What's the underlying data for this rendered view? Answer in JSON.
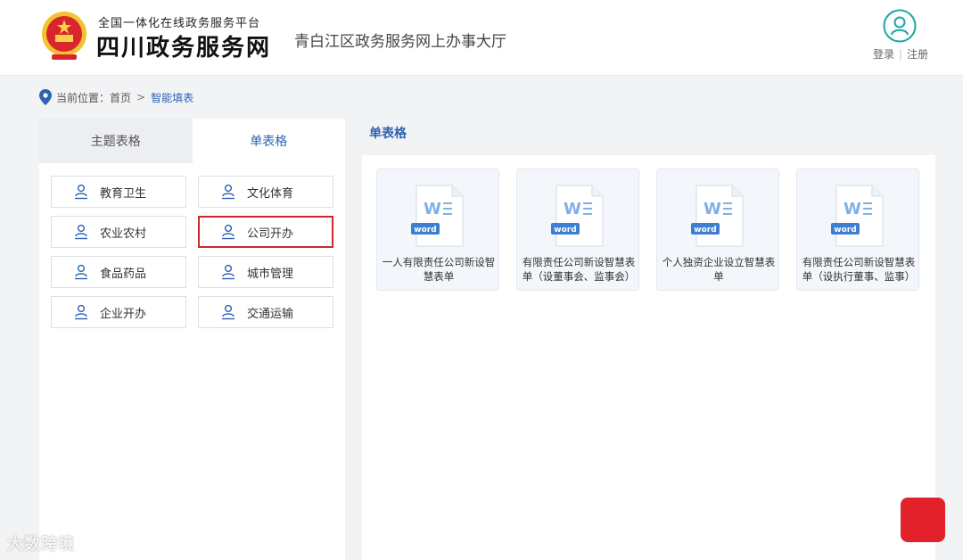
{
  "header": {
    "platform_subtitle": "全国一体化在线政务服务平台",
    "platform_name": "四川政务服务网",
    "site_title": "青白江区政务服务网上办事大厅",
    "login_label": "登录",
    "separator": "|",
    "register_label": "注册"
  },
  "breadcrumb": {
    "prefix": "当前位置：",
    "home": "首页",
    "arrow": ">",
    "current": "智能填表"
  },
  "tabs": [
    {
      "label": "主题表格",
      "active": false
    },
    {
      "label": "单表格",
      "active": true
    }
  ],
  "categories": [
    {
      "label": "教育卫生",
      "selected": false
    },
    {
      "label": "文化体育",
      "selected": false
    },
    {
      "label": "农业农村",
      "selected": false
    },
    {
      "label": "公司开办",
      "selected": true
    },
    {
      "label": "食品药品",
      "selected": false
    },
    {
      "label": "城市管理",
      "selected": false
    },
    {
      "label": "企业开办",
      "selected": false
    },
    {
      "label": "交通运输",
      "selected": false
    }
  ],
  "right_section": {
    "title": "单表格",
    "forms": [
      {
        "badge": "word",
        "label": "一人有限责任公司新设智慧表单"
      },
      {
        "badge": "word",
        "label": "有限责任公司新设智慧表单（设董事会、监事会）"
      },
      {
        "badge": "word",
        "label": "个人独资企业设立智慧表单"
      },
      {
        "badge": "word",
        "label": "有限责任公司新设智慧表单（设执行董事、监事）"
      }
    ]
  },
  "watermark": {
    "left_text": "大数跨境"
  },
  "colors": {
    "accent_blue": "#2d62b4",
    "selected_border": "#d0282e",
    "word_blue": "#3d7fd0",
    "user_icon_teal": "#1aa8a0"
  }
}
